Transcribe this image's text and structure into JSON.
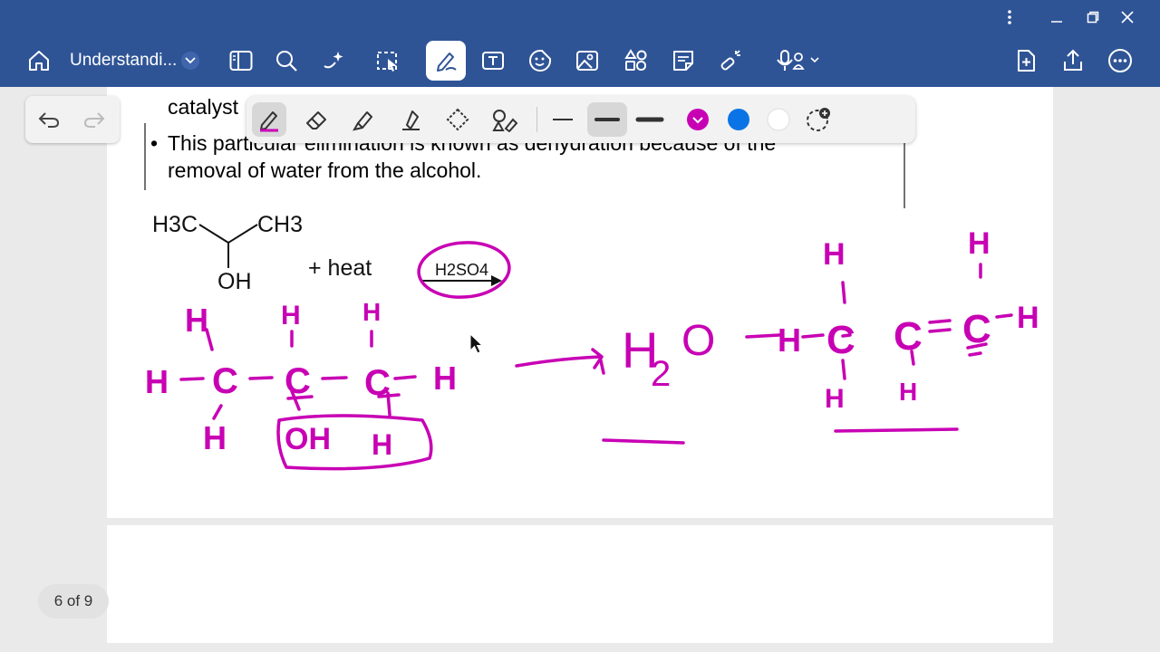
{
  "app": {
    "document_title": "Understandi...",
    "page_indicator": "6 of 9"
  },
  "slide": {
    "bullet_partial": "catalyst",
    "bullet2_line1": "This particular elimination is known as dehydration because of the",
    "bullet2_line2": "removal of water from the alcohol.",
    "bullet_symbol": "•",
    "molecule": {
      "left_group": "H3C",
      "right_group": "CH3",
      "hydroxyl": "OH",
      "plus_heat": "+ heat",
      "catalyst": "H2SO4"
    }
  },
  "ink": {
    "color": "#c800b4",
    "reactant_left": "H",
    "reactant_c1": "C",
    "reactant_c2": "C",
    "reactant_c3": "C",
    "reactant_right": "H",
    "reactant_top_h1": "H",
    "reactant_top_h2": "H",
    "reactant_top_h3": "H",
    "reactant_bottom_h1": "H",
    "circled_oh": "OH",
    "circled_h": "H",
    "water_h": "H",
    "water_sub": "2",
    "water_o": "O",
    "product_left": "H",
    "product_c1": "C",
    "product_c2": "C",
    "product_c3": "C",
    "product_right": "H",
    "product_top_h1": "H",
    "product_top_h2": "H",
    "product_bottom_h1": "H",
    "product_bottom_h2": "H",
    "bond_single": "-",
    "bond_double": "="
  },
  "pen_toolbar": {
    "tools": [
      "pen-icon",
      "eraser-icon",
      "highlighter-icon",
      "marker-icon",
      "lasso-icon",
      "shape-icon"
    ],
    "stroke_widths": [
      "thin",
      "medium",
      "thick"
    ],
    "colors": [
      "#c800b4",
      "#0a74e6",
      "#ffffff"
    ],
    "selected_tool": "pen-icon",
    "selected_width": "medium",
    "selected_color": "#c800b4"
  },
  "theme": {
    "toolbar_bg": "#2f5496",
    "page_bg": "#ffffff"
  }
}
